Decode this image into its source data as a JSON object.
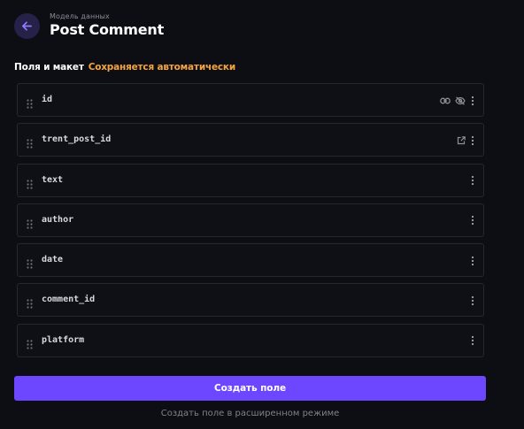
{
  "header": {
    "back_icon": "arrow-left-icon",
    "subtitle": "Модель данных",
    "title": "Post Comment"
  },
  "section": {
    "title": "Поля и макет",
    "status": "Сохраняется автоматически"
  },
  "colors": {
    "background": "#0d0e13",
    "accent": "#6c47ff",
    "status": "#f5a53f",
    "row_border": "#262830"
  },
  "fields": [
    {
      "name": "id",
      "icons": [
        "link-icon",
        "eye-off-icon",
        "more-vertical-icon"
      ]
    },
    {
      "name": "trent_post_id",
      "icons": [
        "external-link-icon",
        "more-vertical-icon"
      ]
    },
    {
      "name": "text",
      "icons": [
        "more-vertical-icon"
      ]
    },
    {
      "name": "author",
      "icons": [
        "more-vertical-icon"
      ]
    },
    {
      "name": "date",
      "icons": [
        "more-vertical-icon"
      ]
    },
    {
      "name": "comment_id",
      "icons": [
        "more-vertical-icon"
      ]
    },
    {
      "name": "platform",
      "icons": [
        "more-vertical-icon"
      ]
    }
  ],
  "actions": {
    "create_field": "Создать поле",
    "create_advanced": "Создать поле в расширенном режиме"
  }
}
